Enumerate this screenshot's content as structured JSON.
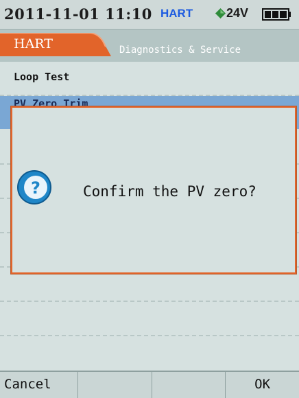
{
  "status_bar": {
    "datetime": "2011-11-01 11:10",
    "protocol": "HART",
    "voltage": "24V",
    "colors": {
      "protocol": "#1e5ce0",
      "voltage_icon": "#2e8b3a"
    },
    "icons": [
      "voltage-diamond-icon",
      "battery-icon"
    ]
  },
  "header": {
    "active_tab": "HART",
    "title": "Diagnostics & Service",
    "colors": {
      "active_tab": "#e2642a"
    }
  },
  "list": {
    "items": [
      {
        "label": "Loop Test"
      },
      {
        "label": "PV Zero Trim",
        "selected": true
      },
      {
        "label": ""
      },
      {
        "label": ""
      },
      {
        "label": ""
      },
      {
        "label": ""
      },
      {
        "label": ""
      },
      {
        "label": ""
      }
    ]
  },
  "dialog": {
    "icon": "question-icon",
    "message": "Confirm the PV zero?",
    "colors": {
      "border": "#e2642a",
      "icon": "#1f86c8"
    }
  },
  "softkeys": [
    {
      "label": "Cancel"
    },
    {
      "label": ""
    },
    {
      "label": ""
    },
    {
      "label": "OK"
    }
  ]
}
